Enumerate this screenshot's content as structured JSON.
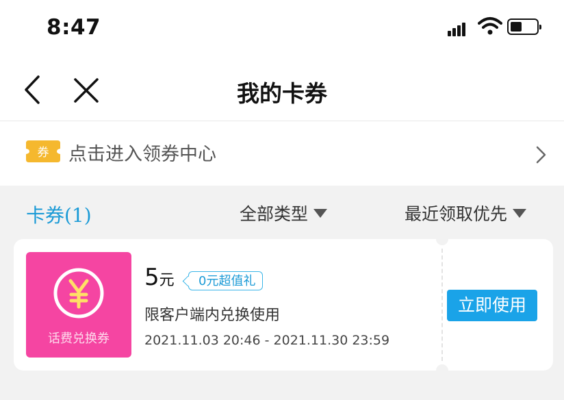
{
  "status_bar": {
    "time": "8:47"
  },
  "nav": {
    "title": "我的卡券"
  },
  "banner": {
    "icon_text": "券",
    "text": "点击进入领券中心"
  },
  "filters": {
    "tab_label": "卡券(1)",
    "type_label": "全部类型",
    "sort_label": "最近领取优先"
  },
  "coupon": {
    "thumb_label": "话费兑换券",
    "amount": "5",
    "unit": "元",
    "badge": "0元超值礼",
    "description": "限客户端内兑换使用",
    "period": "2021.11.03 20:46 - 2021.11.30 23:59",
    "action_label": "立即使用"
  },
  "colors": {
    "accent": "#1aa3e8",
    "thumb_bg": "#f545a2",
    "coupon_icon": "#f5b82e"
  }
}
